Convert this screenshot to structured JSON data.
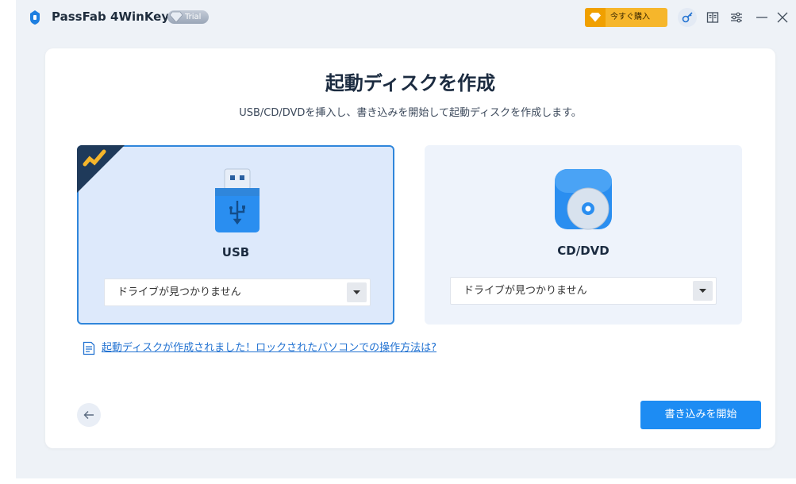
{
  "app": {
    "name": "PassFab 4WinKey",
    "edition_badge": "Trial"
  },
  "titlebar": {
    "buy_label": "今すぐ購入"
  },
  "main": {
    "title": "起動ディスクを作成",
    "subtitle": "USB/CD/DVDを挿入し、書き込みを開始して起動ディスクを作成します。",
    "options": [
      {
        "label": "USB",
        "selected": true,
        "drive_value": "ドライブが見つかりません"
      },
      {
        "label": "CD/DVD",
        "selected": false,
        "drive_value": "ドライブが見つかりません"
      }
    ],
    "help_link": "起動ディスクが作成されました！ロックされたパソコンでの操作方法は?",
    "start_button": "書き込みを開始"
  },
  "colors": {
    "accent": "#1d8cf3",
    "selected_border": "#2f86db",
    "buy": "#f6b62b",
    "corner": "#1f3a5a"
  }
}
